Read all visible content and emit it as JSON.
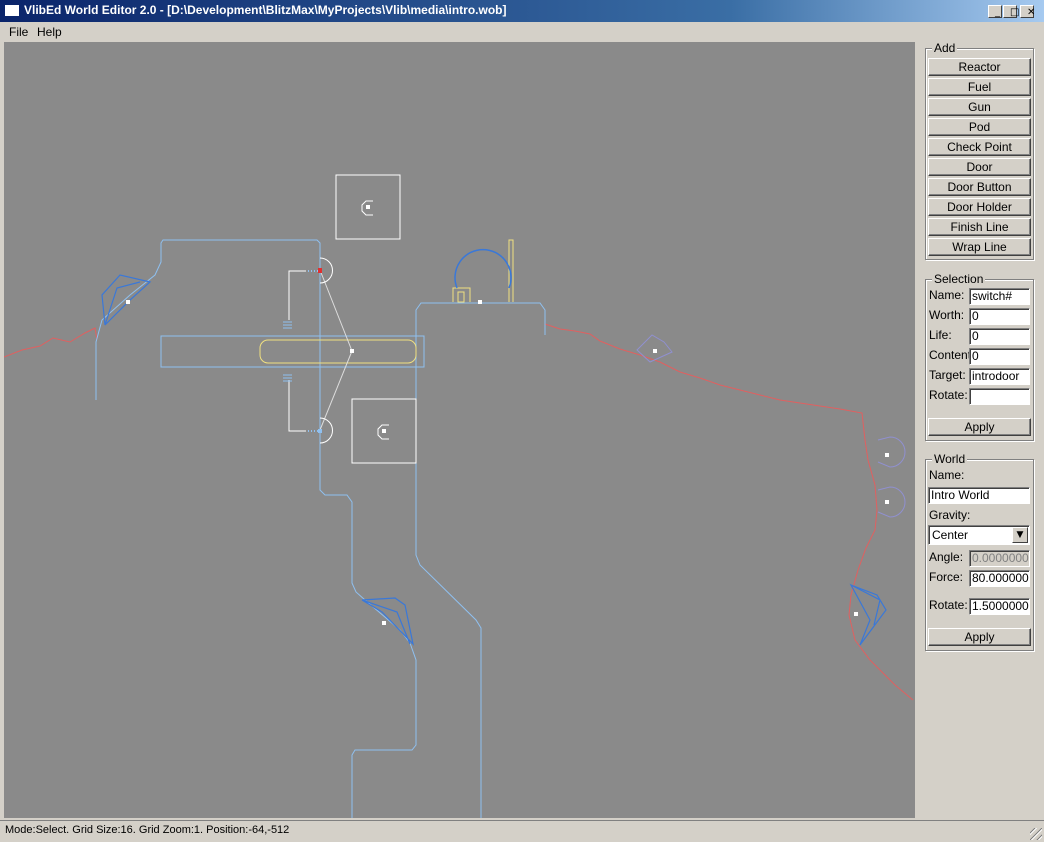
{
  "window": {
    "title": "VlibEd World Editor 2.0 - [D:\\Development\\BlitzMax\\MyProjects\\Vlib\\media\\intro.wob]",
    "minimize_glyph": "_",
    "maximize_glyph": "□",
    "close_glyph": "✕"
  },
  "menu": {
    "file": "File",
    "help": "Help"
  },
  "add_panel": {
    "title": "Add",
    "buttons": [
      "Reactor",
      "Fuel",
      "Gun",
      "Pod",
      "Check Point",
      "Door",
      "Door Button",
      "Door Holder",
      "Finish Line",
      "Wrap Line"
    ]
  },
  "selection_panel": {
    "title": "Selection",
    "name_label": "Name:",
    "name_value": "switch#",
    "worth_label": "Worth:",
    "worth_value": "0",
    "life_label": "Life:",
    "life_value": "0",
    "content_label": "Content:",
    "content_value": "0",
    "target_label": "Target:",
    "target_value": "introdoor",
    "rotate_label": "Rotate:",
    "rotate_value": "",
    "apply": "Apply"
  },
  "world_panel": {
    "title": "World",
    "name_label": "Name:",
    "name_value": "Intro World",
    "gravity_label": "Gravity:",
    "gravity_value": "Center",
    "angle_label": "Angle:",
    "angle_value": "0.0000000",
    "force_label": "Force:",
    "force_value": "80.000000",
    "rotate_label": "Rotate:",
    "rotate_value": "1.5000000",
    "apply": "Apply"
  },
  "status": {
    "text": "Mode:Select.  Grid Size:16. Grid Zoom:1. Position:-64,-512"
  },
  "colors": {
    "canvas": "#8a8a8a",
    "wall": "#8fc0f0",
    "terrain": "#e06060",
    "door": "#f0e080",
    "object": "#3a78d8",
    "handle": "#ffffff"
  }
}
